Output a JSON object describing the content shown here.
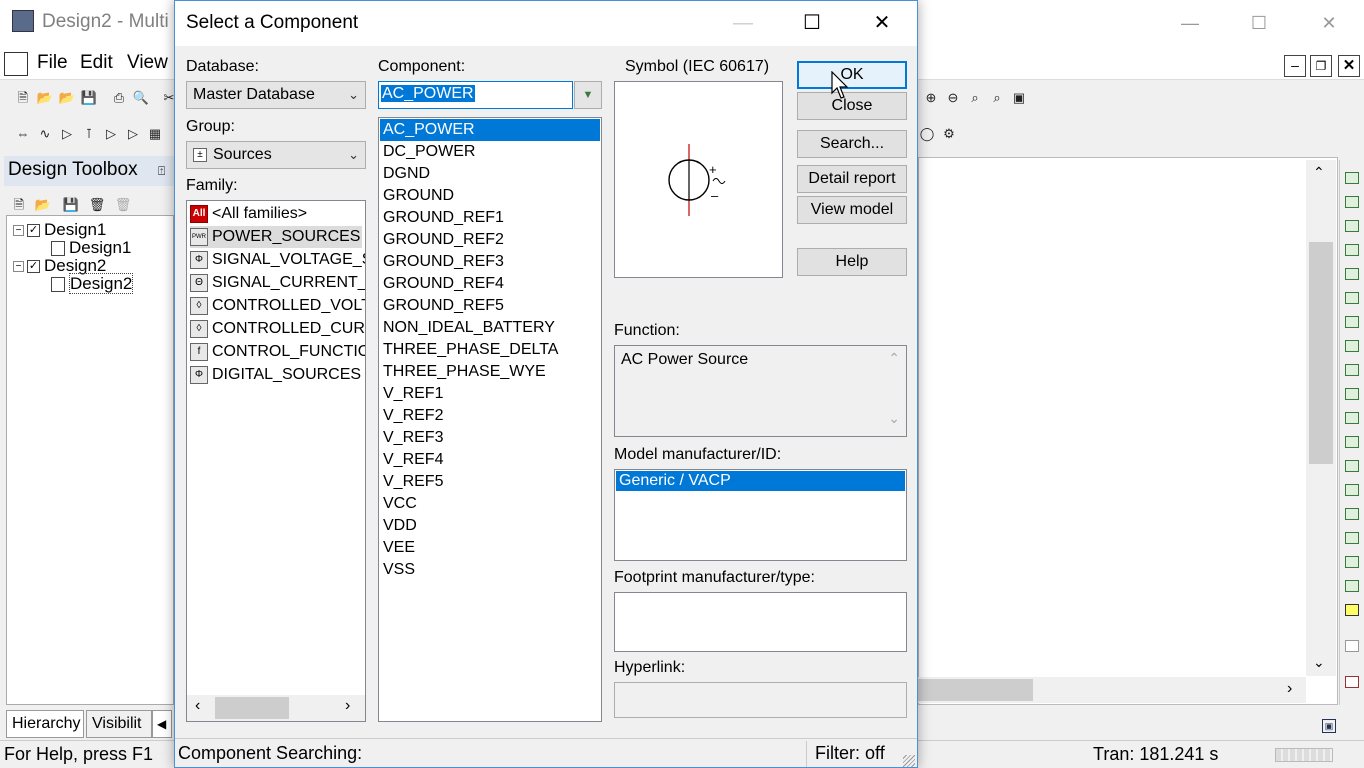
{
  "main_window": {
    "title": "Design2 - Multi",
    "menu": [
      "File",
      "Edit",
      "View"
    ],
    "toolbox_title": "Design Toolbox",
    "tree": [
      {
        "label": "Design1",
        "level": 0
      },
      {
        "label": "Design1",
        "level": 1
      },
      {
        "label": "Design2",
        "level": 0
      },
      {
        "label": "Design2",
        "level": 1
      }
    ],
    "tabs": [
      "Hierarchy",
      "Visibilit"
    ],
    "status_help": "For Help, press F1",
    "status_tran": "Tran: 181.241 s"
  },
  "dialog": {
    "title": "Select a Component",
    "database_label": "Database:",
    "database_value": "Master Database",
    "group_label": "Group:",
    "group_value": "Sources",
    "family_label": "Family:",
    "families": [
      {
        "label": "<All families>",
        "icon": "All"
      },
      {
        "label": "POWER_SOURCES",
        "icon": "PWR"
      },
      {
        "label": "SIGNAL_VOLTAGE_S",
        "icon": "Φ"
      },
      {
        "label": "SIGNAL_CURRENT_S",
        "icon": "Θ"
      },
      {
        "label": "CONTROLLED_VOLT",
        "icon": "◊"
      },
      {
        "label": "CONTROLLED_CURR",
        "icon": "◊"
      },
      {
        "label": "CONTROL_FUNCTIO",
        "icon": "f"
      },
      {
        "label": "DIGITAL_SOURCES",
        "icon": "Φ"
      }
    ],
    "selected_family": 1,
    "component_label": "Component:",
    "component_value": "AC_POWER",
    "components": [
      "AC_POWER",
      "DC_POWER",
      "DGND",
      "GROUND",
      "GROUND_REF1",
      "GROUND_REF2",
      "GROUND_REF3",
      "GROUND_REF4",
      "GROUND_REF5",
      "NON_IDEAL_BATTERY",
      "THREE_PHASE_DELTA",
      "THREE_PHASE_WYE",
      "V_REF1",
      "V_REF2",
      "V_REF3",
      "V_REF4",
      "V_REF5",
      "VCC",
      "VDD",
      "VEE",
      "VSS"
    ],
    "selected_component": 0,
    "symbol_label": "Symbol (IEC 60617)",
    "buttons": {
      "ok": "OK",
      "close": "Close",
      "search": "Search...",
      "detail_report": "Detail report",
      "view_model": "View model",
      "help": "Help"
    },
    "function_label": "Function:",
    "function_value": "AC Power Source",
    "model_label": "Model manufacturer/ID:",
    "model_value": "Generic / VACP",
    "footprint_label": "Footprint manufacturer/type:",
    "hyperlink_label": "Hyperlink:",
    "status_searching": "Component Searching:",
    "status_filter": "Filter: off"
  },
  "colors": {
    "selection": "#0078d7",
    "dialog_border": "#4a90d9"
  }
}
